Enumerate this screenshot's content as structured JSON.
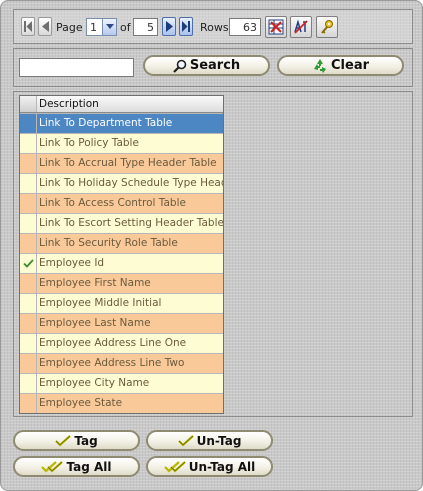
{
  "pager": {
    "page_label": "Page",
    "page_value": "1",
    "of_label": "of",
    "total_pages": "5",
    "rows_label": "Rows",
    "rows_count": "63"
  },
  "search": {
    "input_value": "",
    "search_label": "Search",
    "clear_label": "Clear"
  },
  "grid": {
    "header": "Description",
    "rows": [
      {
        "label": "Link To Department Table",
        "checked": false,
        "selected": true
      },
      {
        "label": "Link To Policy Table",
        "checked": false,
        "selected": false
      },
      {
        "label": "Link To Accrual Type Header Table",
        "checked": false,
        "selected": false
      },
      {
        "label": "Link To Holiday Schedule Type Header",
        "checked": false,
        "selected": false
      },
      {
        "label": "Link To Access Control Table",
        "checked": false,
        "selected": false
      },
      {
        "label": "Link To Escort Setting Header Table",
        "checked": false,
        "selected": false
      },
      {
        "label": "Link To Security Role Table",
        "checked": false,
        "selected": false
      },
      {
        "label": "Employee Id",
        "checked": true,
        "selected": false
      },
      {
        "label": "Employee First Name",
        "checked": false,
        "selected": false
      },
      {
        "label": "Employee Middle Initial",
        "checked": false,
        "selected": false
      },
      {
        "label": "Employee Last Name",
        "checked": false,
        "selected": false
      },
      {
        "label": "Employee Address Line One",
        "checked": false,
        "selected": false
      },
      {
        "label": "Employee Address Line Two",
        "checked": false,
        "selected": false
      },
      {
        "label": "Employee City Name",
        "checked": false,
        "selected": false
      },
      {
        "label": "Employee State",
        "checked": false,
        "selected": false
      }
    ]
  },
  "actions": {
    "tag_label": "Tag",
    "untag_label": "Un-Tag",
    "tag_all_label": "Tag All",
    "untag_all_label": "Un-Tag All"
  },
  "icons": {
    "first_page": "first-page-icon",
    "prev_page": "prev-page-icon",
    "next_page": "next-page-icon",
    "last_page": "last-page-icon",
    "export": "export-icon",
    "sort": "sort-icon",
    "key": "key-icon",
    "search": "magnifier-icon",
    "clear": "recycle-icon",
    "check": "checkmark-icon"
  },
  "colors": {
    "row_selected": "#4c86c3",
    "row_light": "#fdfcd3",
    "row_orange": "#f9c99a",
    "checkmark": "#3a8a2a",
    "tag_check": "#c8c800"
  }
}
